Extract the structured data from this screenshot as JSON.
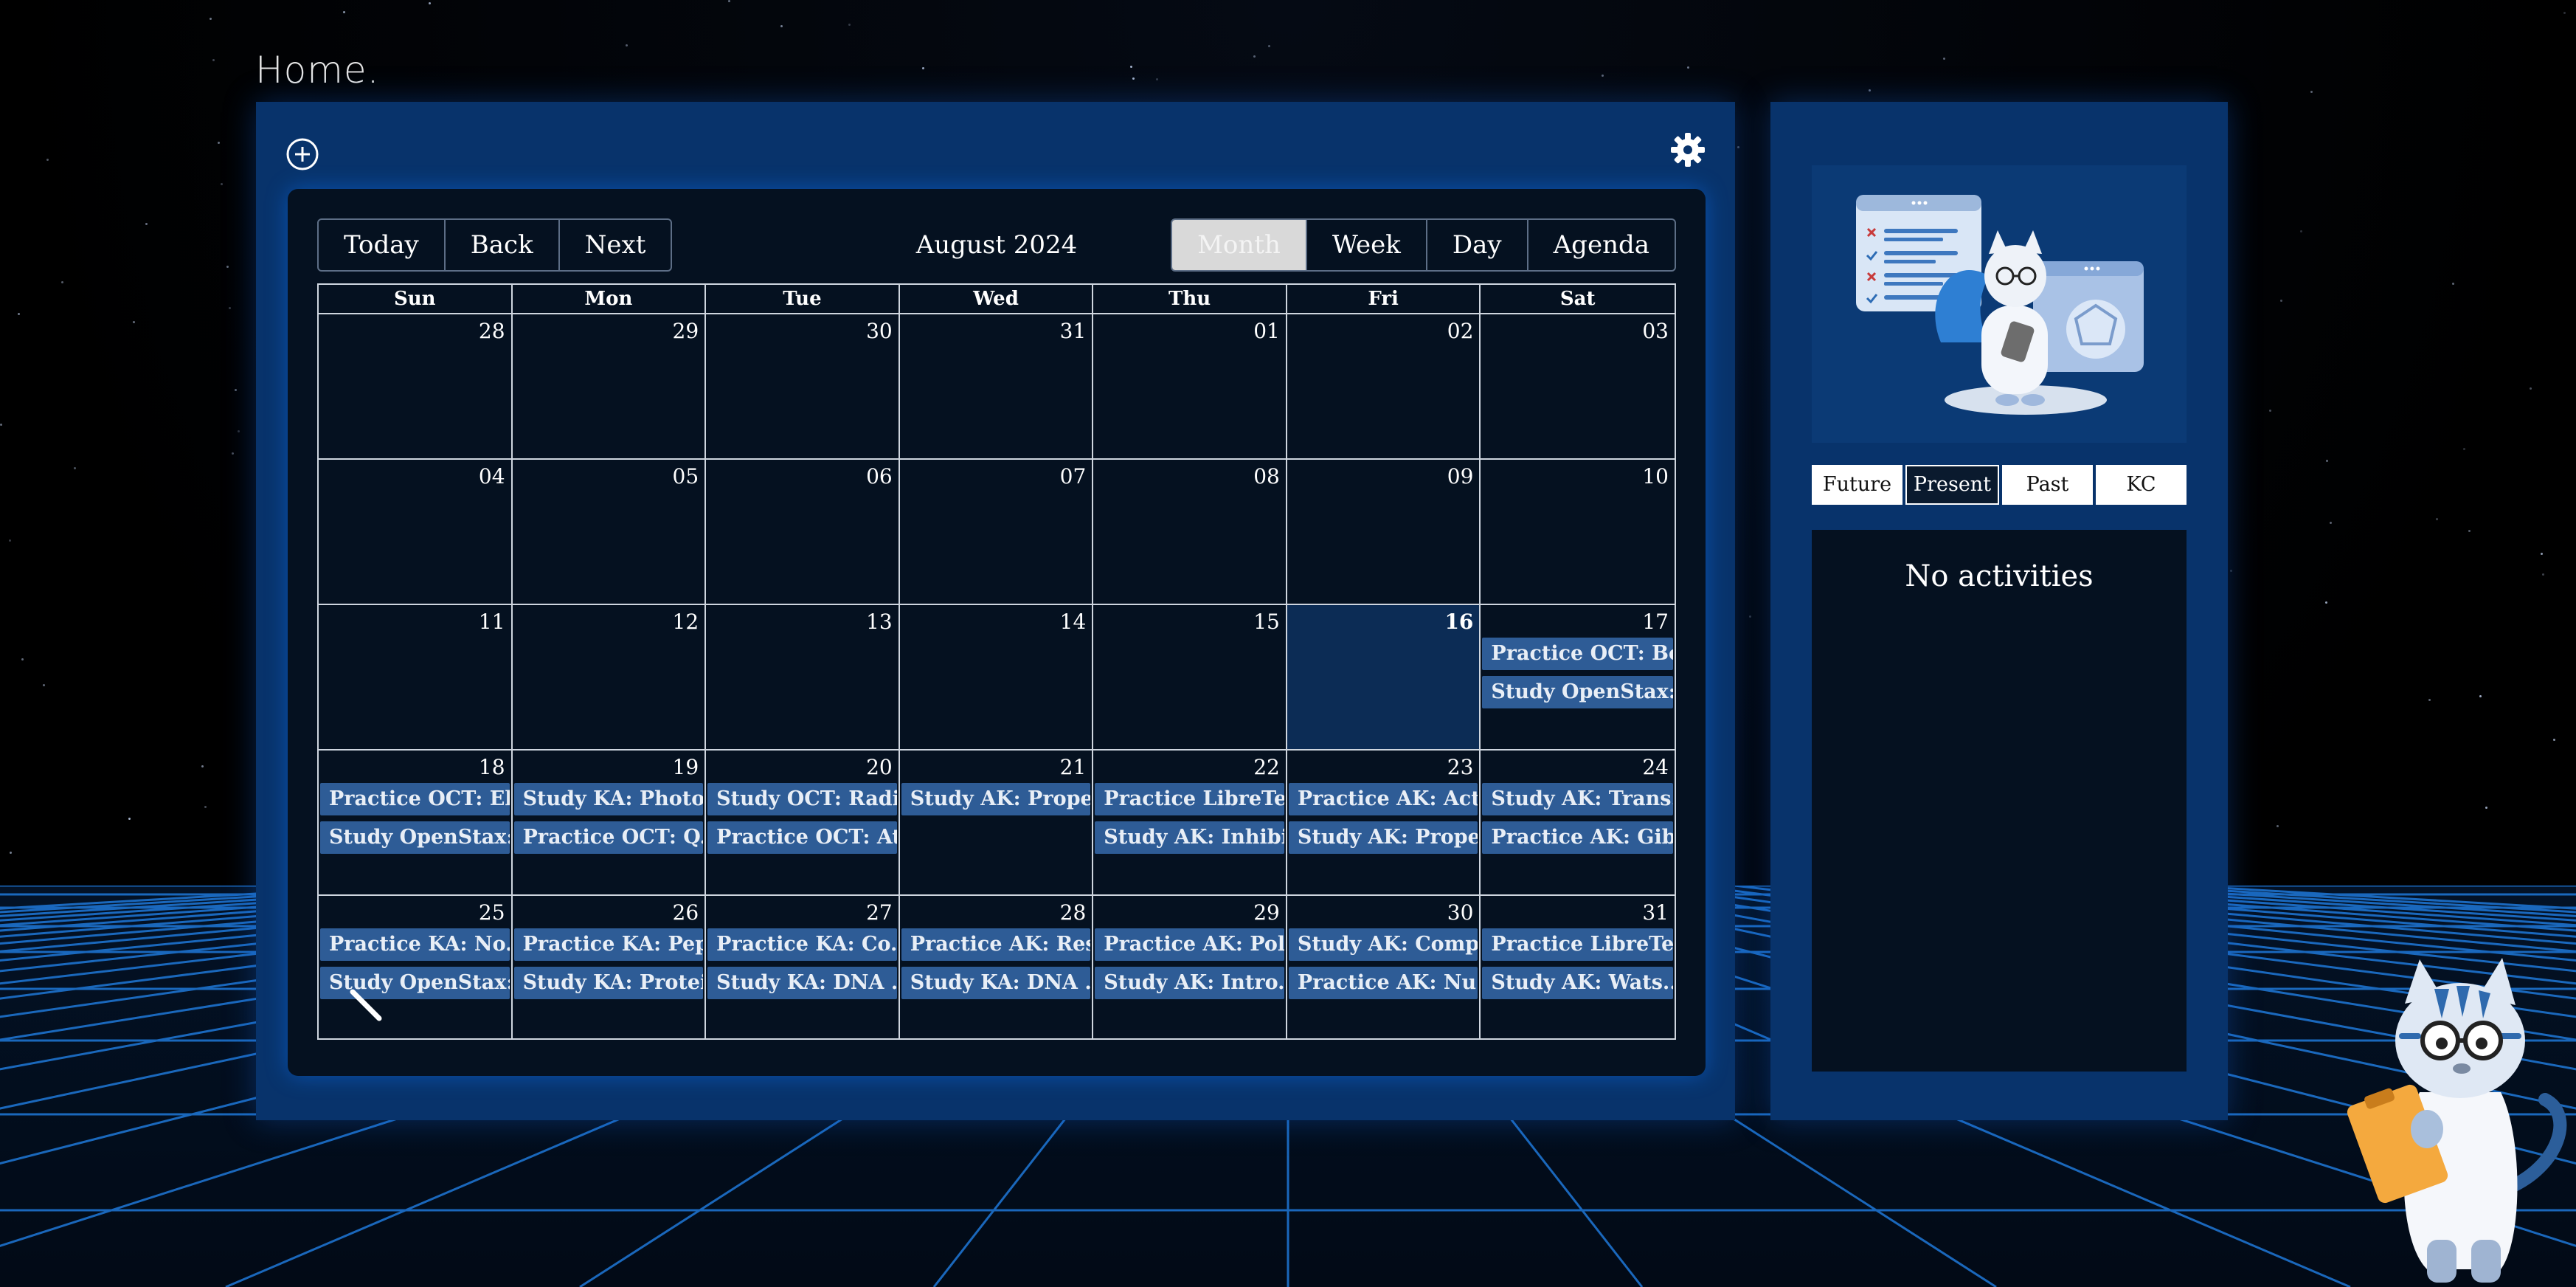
{
  "page": {
    "title": "Home."
  },
  "toolbar": {
    "today": "Today",
    "back": "Back",
    "next": "Next",
    "label": "August 2024",
    "views": [
      "Month",
      "Week",
      "Day",
      "Agenda"
    ],
    "active_view": "Month"
  },
  "weekdays": [
    "Sun",
    "Mon",
    "Tue",
    "Wed",
    "Thu",
    "Fri",
    "Sat"
  ],
  "weeks": [
    [
      {
        "day": "28",
        "events": []
      },
      {
        "day": "29",
        "events": []
      },
      {
        "day": "30",
        "events": []
      },
      {
        "day": "31",
        "events": []
      },
      {
        "day": "01",
        "events": []
      },
      {
        "day": "02",
        "events": []
      },
      {
        "day": "03",
        "events": []
      }
    ],
    [
      {
        "day": "04",
        "events": []
      },
      {
        "day": "05",
        "events": []
      },
      {
        "day": "06",
        "events": []
      },
      {
        "day": "07",
        "events": []
      },
      {
        "day": "08",
        "events": []
      },
      {
        "day": "09",
        "events": []
      },
      {
        "day": "10",
        "events": []
      }
    ],
    [
      {
        "day": "11",
        "events": []
      },
      {
        "day": "12",
        "events": []
      },
      {
        "day": "13",
        "events": []
      },
      {
        "day": "14",
        "events": []
      },
      {
        "day": "15",
        "events": []
      },
      {
        "day": "16",
        "events": [],
        "today": true
      },
      {
        "day": "17",
        "events": [
          "Practice OCT: Bo...",
          "Study OpenStax:..."
        ]
      }
    ],
    [
      {
        "day": "18",
        "events": [
          "Practice OCT: El...",
          "Study OpenStax:..."
        ]
      },
      {
        "day": "19",
        "events": [
          "Study KA: Photo...",
          "Practice OCT: Q..."
        ]
      },
      {
        "day": "20",
        "events": [
          "Study OCT: Radi...",
          "Practice OCT: At..."
        ]
      },
      {
        "day": "21",
        "events": [
          "Study AK: Prope..."
        ]
      },
      {
        "day": "22",
        "events": [
          "Practice LibreTe...",
          "Study AK: Inhibi..."
        ]
      },
      {
        "day": "23",
        "events": [
          "Practice AK: Act...",
          "Study AK: Prope..."
        ]
      },
      {
        "day": "24",
        "events": [
          "Study AK: Trans...",
          "Practice AK: Gib..."
        ]
      }
    ],
    [
      {
        "day": "25",
        "events": [
          "Practice KA: No...",
          "Study OpenStax:..."
        ]
      },
      {
        "day": "26",
        "events": [
          "Practice KA: Pep...",
          "Study KA: Protei..."
        ]
      },
      {
        "day": "27",
        "events": [
          "Practice KA: Co...",
          "Study KA: DNA ..."
        ]
      },
      {
        "day": "28",
        "events": [
          "Practice AK: Res...",
          "Study KA: DNA ..."
        ]
      },
      {
        "day": "29",
        "events": [
          "Practice AK: Pol...",
          "Study AK: Intro..."
        ]
      },
      {
        "day": "30",
        "events": [
          "Study AK: Comp...",
          "Practice AK: Nu..."
        ]
      },
      {
        "day": "31",
        "events": [
          "Practice LibreTe...",
          "Study AK: Wats..."
        ]
      }
    ]
  ],
  "sidebar": {
    "tabs": [
      "Future",
      "Present",
      "Past",
      "KC"
    ],
    "active_tab": "Present",
    "empty_message": "No activities"
  },
  "colors": {
    "panel": "#08336b",
    "calendar_bg": "#051120",
    "event": "#2e5c96",
    "today_cell": "#0c2c55"
  },
  "icons": {
    "add": "add-circle-icon",
    "settings": "gear-icon",
    "cursor": "pencil-cursor-icon"
  }
}
